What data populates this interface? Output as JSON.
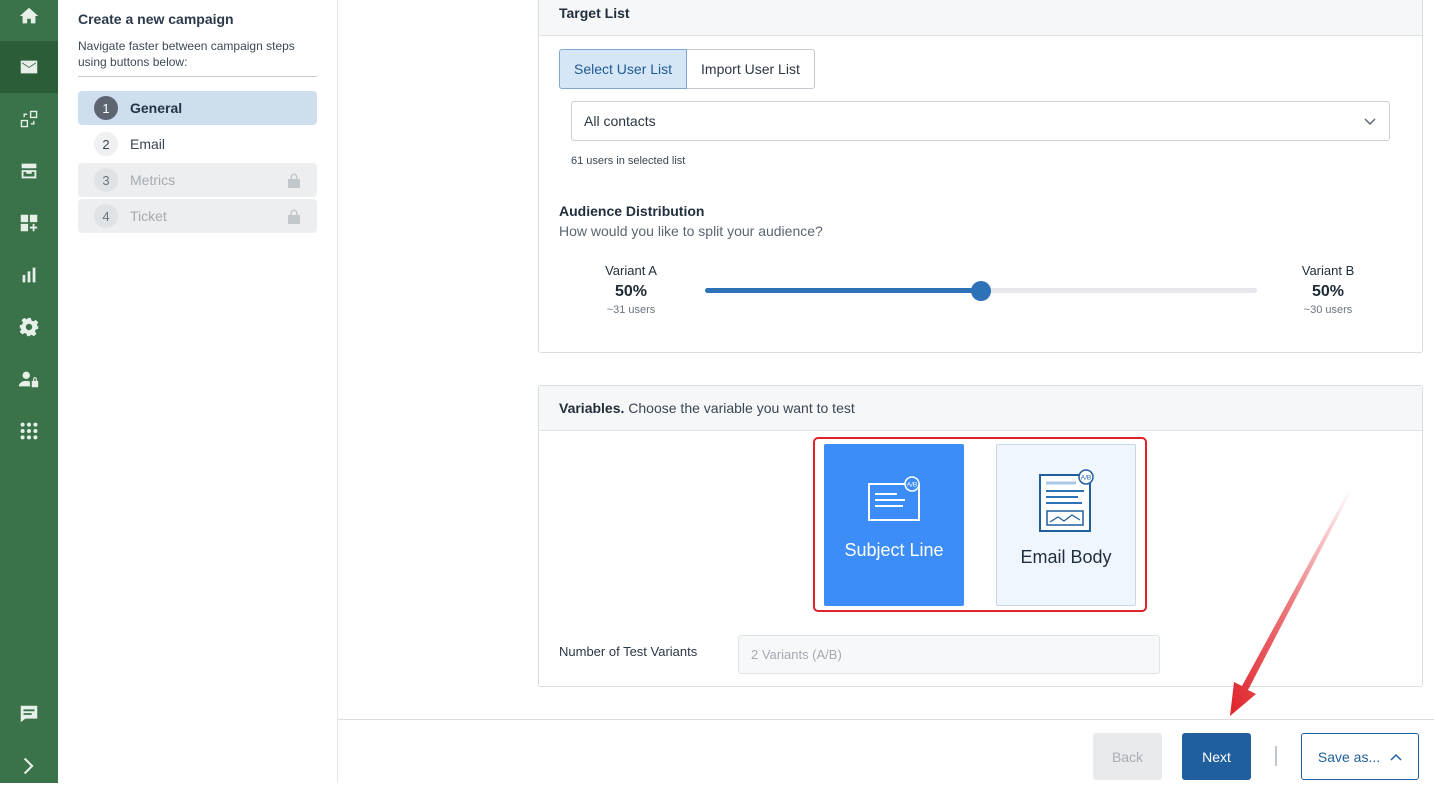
{
  "rail": {
    "icons": [
      "home-icon",
      "mail-icon",
      "flows-icon",
      "inbox-icon",
      "apps-add-icon",
      "bar-chart-icon",
      "gear-icon",
      "user-lock-icon",
      "grid-dots-icon",
      "chat-icon",
      "chevron-right-icon"
    ],
    "active": "mail-icon"
  },
  "steps": {
    "title": "Create a new campaign",
    "hint": "Navigate faster between campaign steps using buttons below:",
    "items": [
      {
        "num": "1",
        "label": "General",
        "state": "active"
      },
      {
        "num": "2",
        "label": "Email",
        "state": "normal"
      },
      {
        "num": "3",
        "label": "Metrics",
        "state": "locked"
      },
      {
        "num": "4",
        "label": "Ticket",
        "state": "locked"
      }
    ]
  },
  "target": {
    "heading": "Target List",
    "tab_select": "Select User List",
    "tab_import": "Import User List",
    "list_value": "All contacts",
    "users_note": "61 users in selected list",
    "dist_title": "Audience Distribution",
    "dist_sub": "How would you like to split your audience?",
    "variant_a": {
      "name": "Variant A",
      "percent": "50%",
      "users": "~31 users"
    },
    "variant_b": {
      "name": "Variant B",
      "percent": "50%",
      "users": "~30 users"
    },
    "split_fraction": 0.5
  },
  "variables": {
    "heading_bold": "Variables.",
    "heading_rest": "Choose the variable you want to test",
    "option_subject": "Subject Line",
    "option_body": "Email Body",
    "selected": "Subject Line",
    "num_label": "Number of Test Variants",
    "num_value": "2 Variants (A/B)"
  },
  "footer": {
    "back": "Back",
    "next": "Next",
    "save": "Save as..."
  },
  "colors": {
    "rail": "#3a7349",
    "accent": "#1f5f9e",
    "selected_card": "#3c8df7",
    "highlight": "#e0222a"
  }
}
